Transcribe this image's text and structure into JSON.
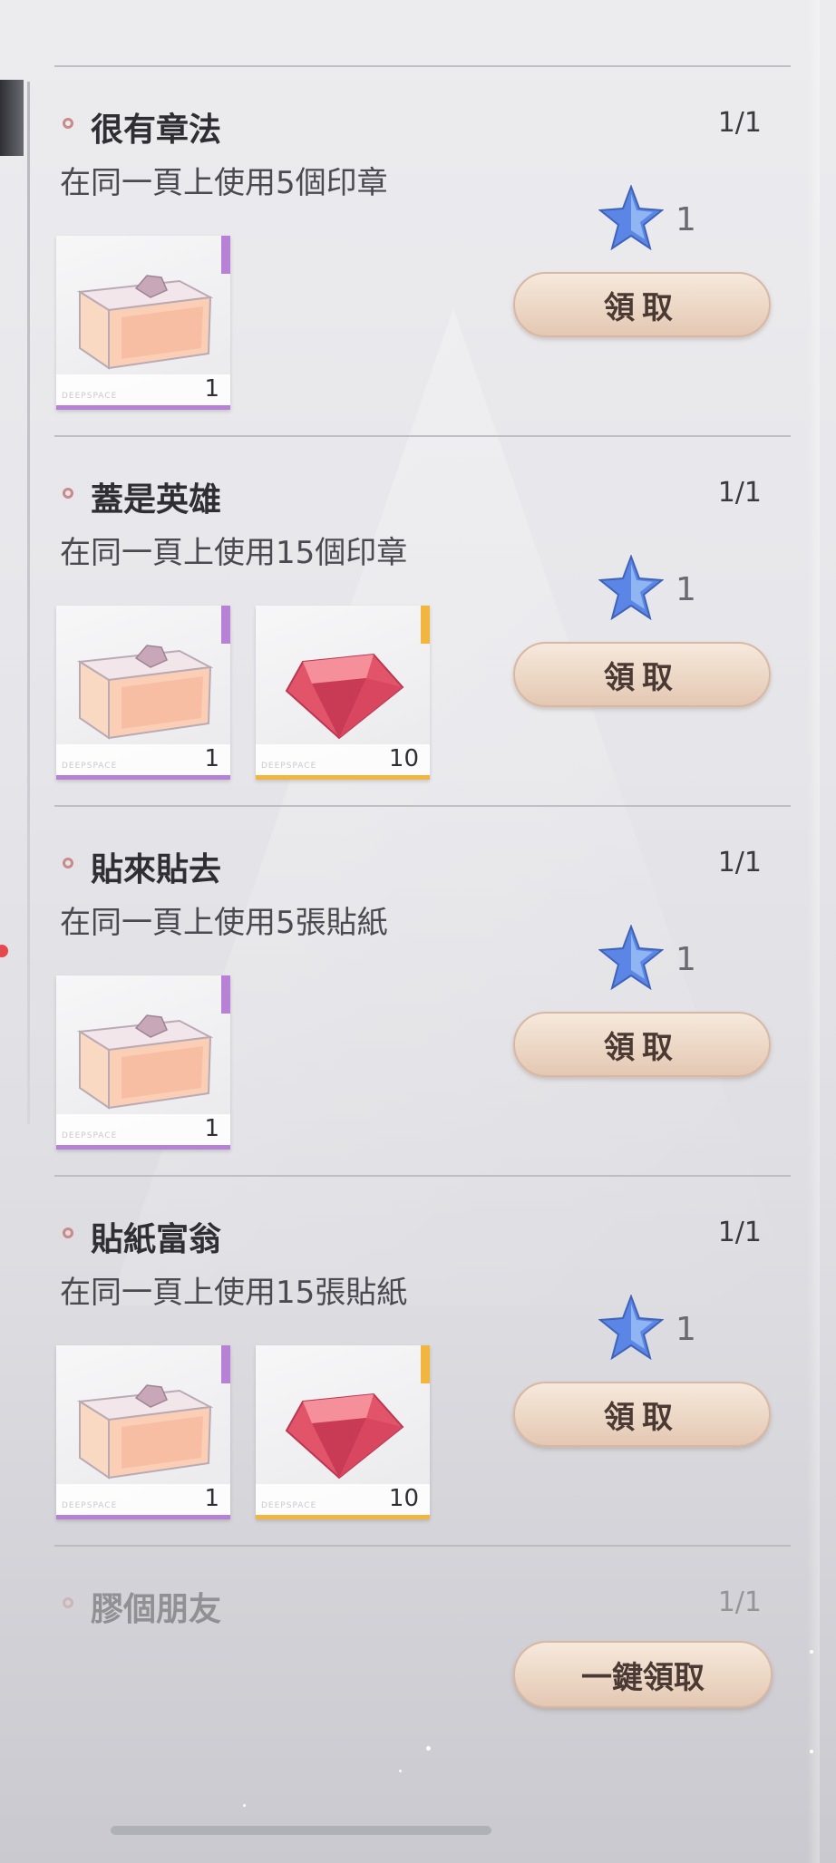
{
  "tasks": [
    {
      "title": "很有章法",
      "progress": "1/1",
      "desc": "在同一頁上使用5個印章",
      "rewards": [
        {
          "name": "glass-chest-icon",
          "count": "1",
          "rarity": "purple"
        }
      ],
      "stars": "1",
      "button": "領取"
    },
    {
      "title": "蓋是英雄",
      "progress": "1/1",
      "desc": "在同一頁上使用15個印章",
      "rewards": [
        {
          "name": "glass-chest-icon",
          "count": "1",
          "rarity": "purple"
        },
        {
          "name": "red-diamond-icon",
          "count": "10",
          "rarity": "gold"
        }
      ],
      "stars": "1",
      "button": "領取"
    },
    {
      "title": "貼來貼去",
      "progress": "1/1",
      "desc": "在同一頁上使用5張貼紙",
      "rewards": [
        {
          "name": "glass-chest-icon",
          "count": "1",
          "rarity": "purple"
        }
      ],
      "stars": "1",
      "button": "領取"
    },
    {
      "title": "貼紙富翁",
      "progress": "1/1",
      "desc": "在同一頁上使用15張貼紙",
      "rewards": [
        {
          "name": "glass-chest-icon",
          "count": "1",
          "rarity": "purple"
        },
        {
          "name": "red-diamond-icon",
          "count": "10",
          "rarity": "gold"
        }
      ],
      "stars": "1",
      "button": "領取"
    },
    {
      "title": "膠個朋友",
      "progress": "1/1"
    }
  ],
  "claim_all_button": "一鍵領取",
  "colors": {
    "accent": "#ecd7c5",
    "purple_rarity": "#b782d6",
    "gold_rarity": "#f2b640",
    "star": "#5b86e6"
  }
}
